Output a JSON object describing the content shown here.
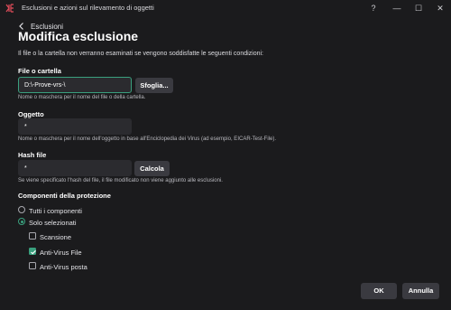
{
  "window": {
    "title": "Esclusioni e azioni sul rilevamento di oggetti",
    "help_symbol": "?",
    "minimize_symbol": "—",
    "maximize_symbol": "☐",
    "close_symbol": "✕",
    "accent_color": "#3aa07e"
  },
  "nav": {
    "back_label": "Esclusioni"
  },
  "page": {
    "title": "Modifica esclusione",
    "description": "Il file o la cartella non verranno esaminati se vengono soddisfatte le seguenti condizioni:"
  },
  "file_folder": {
    "label": "File o cartella",
    "value": "D:\\-Prove-vrs-\\",
    "browse_label": "Sfoglia...",
    "hint": "Nome o maschera per il nome del file o della cartella."
  },
  "object": {
    "label": "Oggetto",
    "value": "*",
    "hint": "Nome o maschera per il nome dell'oggetto in base all'Enciclopedia dei Virus (ad esempio, EICAR-Test-File)."
  },
  "hash": {
    "label": "Hash file",
    "value": "*",
    "compute_label": "Calcola",
    "hint": "Se viene specificato l'hash del file, il file modificato non viene aggiunto alle esclusioni."
  },
  "components": {
    "label": "Componenti della protezione",
    "options": [
      {
        "label": "Tutti i componenti",
        "selected": false
      },
      {
        "label": "Solo selezionati",
        "selected": true
      }
    ],
    "items": [
      {
        "label": "Scansione",
        "checked": false
      },
      {
        "label": "Anti-Virus File",
        "checked": true
      },
      {
        "label": "Anti-Virus posta",
        "checked": false
      }
    ]
  },
  "footer": {
    "ok_label": "OK",
    "cancel_label": "Annulla"
  }
}
